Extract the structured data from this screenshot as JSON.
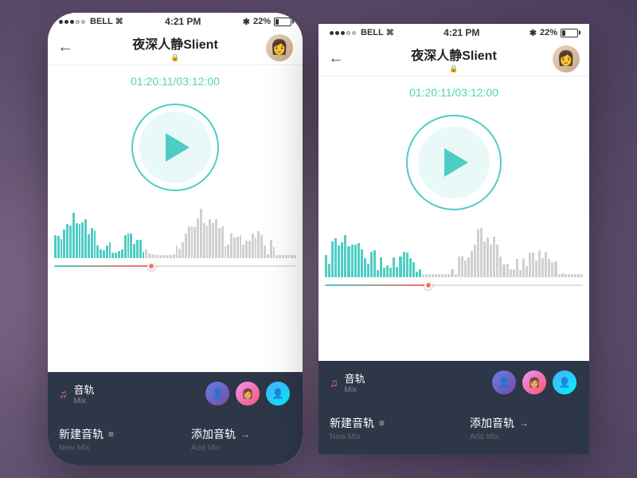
{
  "background": {
    "color": "#7a6a8a"
  },
  "phone_left": {
    "status_bar": {
      "carrier": "BELL",
      "signal_dots": [
        true,
        true,
        true,
        false,
        false
      ],
      "wifi": "📶",
      "time": "4:21 PM",
      "bluetooth": "⚡",
      "battery": "22%"
    },
    "nav": {
      "back_label": "←",
      "title": "夜深人静Slient",
      "lock_icon": "🔒"
    },
    "time_display": "01:20:11/03:12:00",
    "play_button_label": "▶",
    "tracks_section": {
      "icon": "♪",
      "title": "音轨",
      "subtitle": "Mix"
    },
    "actions": [
      {
        "main": "新建音轨",
        "icon": "≡",
        "sub": "New Mix"
      },
      {
        "main": "添加音轨",
        "icon": "→",
        "sub": "Add Mix"
      }
    ]
  },
  "phone_right": {
    "status_bar": {
      "carrier": "BELL",
      "signal_dots": [
        true,
        true,
        true,
        false,
        false
      ],
      "wifi": "📶",
      "time": "4:21 PM",
      "bluetooth": "⚡",
      "battery": "22%"
    },
    "nav": {
      "back_label": "←",
      "title": "夜深人静Slient",
      "lock_icon": "🔒"
    },
    "time_display": "01:20:11/03:12:00",
    "tracks_section": {
      "icon": "♪",
      "title": "音轨",
      "subtitle": "Mix"
    },
    "actions": [
      {
        "main": "新建音轨",
        "icon": "≡",
        "sub": "New Mix"
      },
      {
        "main": "添加音轨",
        "icon": "→",
        "sub": "Add Mix"
      }
    ]
  },
  "waveform": {
    "cyan_end_pct": 38,
    "progress_pct": 40,
    "bar_count": 80
  }
}
